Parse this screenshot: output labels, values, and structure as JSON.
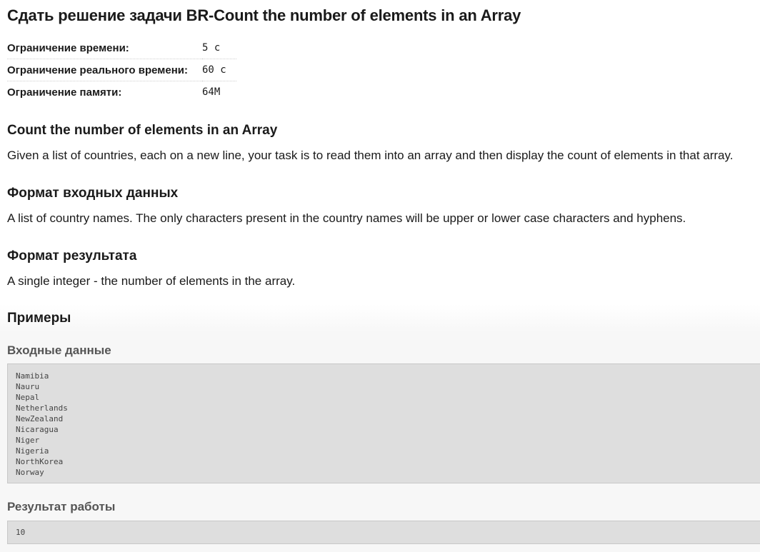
{
  "title": "Сдать решение задачи BR-Count the number of elements in an Array",
  "limits": [
    {
      "label": "Ограничение времени:",
      "value": "5 с"
    },
    {
      "label": "Ограничение реального времени:",
      "value": "60 с"
    },
    {
      "label": "Ограничение памяти:",
      "value": "64M"
    }
  ],
  "statement": {
    "heading": "Count the number of elements in an Array",
    "text": "Given a list of countries, each on a new line, your task is to read them into an array and then display the count of elements in that array."
  },
  "input_format": {
    "heading": "Формат входных данных",
    "text": "A list of country names. The only characters present in the country names will be upper or lower case characters and hyphens."
  },
  "output_format": {
    "heading": "Формат результата",
    "text": "A single integer - the number of elements in the array."
  },
  "examples": {
    "heading": "Примеры",
    "input_label": "Входные данные",
    "input_lines": [
      "Namibia",
      "Nauru",
      "Nepal",
      "Netherlands",
      "NewZealand",
      "Nicaragua",
      "Niger",
      "Nigeria",
      "NorthKorea",
      "Norway"
    ],
    "output_label": "Результат работы",
    "output_lines": [
      "10"
    ]
  }
}
